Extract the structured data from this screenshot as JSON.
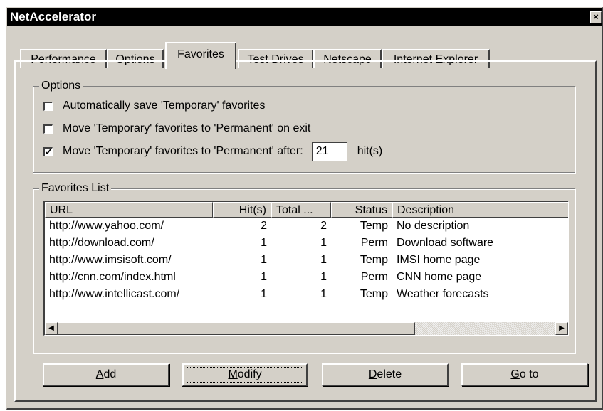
{
  "window": {
    "title": "NetAccelerator",
    "close_glyph": "×"
  },
  "tabs": [
    {
      "label": "Performance",
      "active": false
    },
    {
      "label": "Options",
      "active": false
    },
    {
      "label": "Favorites",
      "active": true
    },
    {
      "label": "Test Drives",
      "active": false
    },
    {
      "label": "Netscape",
      "active": false
    },
    {
      "label": "Internet Explorer",
      "active": false
    }
  ],
  "options_group": {
    "legend": "Options",
    "auto_save": {
      "label": "Automatically save 'Temporary' favorites",
      "checked": false
    },
    "move_on_exit": {
      "label": "Move 'Temporary' favorites to 'Permanent' on exit",
      "checked": false
    },
    "move_after": {
      "label": "Move 'Temporary' favorites to 'Permanent' after:",
      "checked": true,
      "value": "21",
      "suffix": "hit(s)"
    }
  },
  "favorites_group": {
    "legend": "Favorites List",
    "columns": [
      "URL",
      "Hit(s)",
      "Total ...",
      "Status",
      "Description"
    ],
    "rows": [
      {
        "url": "http://www.yahoo.com/",
        "hits": "2",
        "total": "2",
        "status": "Temp",
        "description": "No description"
      },
      {
        "url": "http://download.com/",
        "hits": "1",
        "total": "1",
        "status": "Perm",
        "description": "Download software"
      },
      {
        "url": "http://www.imsisoft.com/",
        "hits": "1",
        "total": "1",
        "status": "Temp",
        "description": "IMSI home page"
      },
      {
        "url": "http://cnn.com/index.html",
        "hits": "1",
        "total": "1",
        "status": "Perm",
        "description": "CNN home page"
      },
      {
        "url": "http://www.intellicast.com/",
        "hits": "1",
        "total": "1",
        "status": "Temp",
        "description": "Weather forecasts"
      }
    ]
  },
  "buttons": {
    "add": {
      "mnemonic": "A",
      "rest": "dd"
    },
    "modify": {
      "mnemonic": "M",
      "rest": "odify"
    },
    "delete": {
      "mnemonic": "D",
      "rest": "elete"
    },
    "goto": {
      "mnemonic": "G",
      "rest": "o to"
    }
  }
}
